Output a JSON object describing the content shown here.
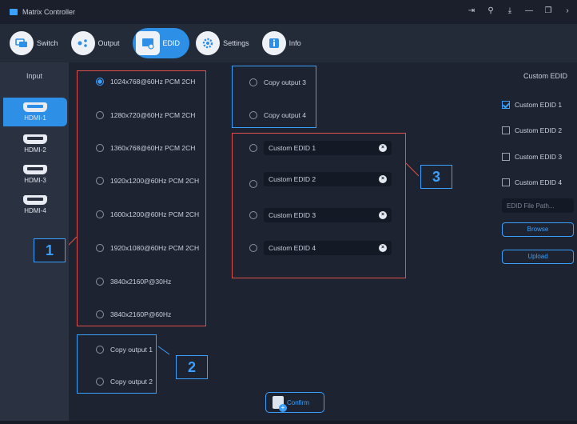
{
  "window": {
    "title": "Matrix Controller"
  },
  "nav": {
    "tabs": [
      {
        "label": "Switch",
        "icon": "switch-icon"
      },
      {
        "label": "Output",
        "icon": "output-icon"
      },
      {
        "label": "EDID",
        "icon": "edid-icon",
        "active": true
      },
      {
        "label": "Settings",
        "icon": "gear-icon"
      },
      {
        "label": "Info",
        "icon": "info-icon"
      }
    ]
  },
  "sidebar": {
    "title": "Input",
    "inputs": [
      {
        "label": "HDMI-1",
        "active": true
      },
      {
        "label": "HDMI-2"
      },
      {
        "label": "HDMI-3"
      },
      {
        "label": "HDMI-4"
      }
    ]
  },
  "edid_presets": [
    {
      "label": "1024x768@60Hz PCM 2CH",
      "checked": true
    },
    {
      "label": "1280x720@60Hz PCM 2CH"
    },
    {
      "label": "1360x768@60Hz PCM  2CH"
    },
    {
      "label": "1920x1200@60Hz PCM  2CH"
    },
    {
      "label": "1600x1200@60Hz PCM 2CH"
    },
    {
      "label": "1920x1080@60Hz PCM 2CH"
    },
    {
      "label": "3840x2160P@30Hz"
    },
    {
      "label": "3840x2160P@60Hz"
    }
  ],
  "copy_outputs_left": [
    {
      "label": "Copy output 1"
    },
    {
      "label": "Copy output 2"
    }
  ],
  "copy_outputs_right": [
    {
      "label": "Copy output 3"
    },
    {
      "label": "Copy output 4"
    }
  ],
  "custom_edid_slots": [
    {
      "label": "Custom EDID 1"
    },
    {
      "label": "Custom EDID 2"
    },
    {
      "label": "Custom EDID 3"
    },
    {
      "label": "Custom EDID 4"
    }
  ],
  "custom_panel": {
    "title": "Custom EDID",
    "checks": [
      {
        "label": "Custom EDID 1",
        "checked": true
      },
      {
        "label": "Custom EDID 2"
      },
      {
        "label": "Custom EDID 3"
      },
      {
        "label": "Custom EDID 4"
      }
    ],
    "path_placeholder": "EDID File Path...",
    "browse_label": "Browse",
    "upload_label": "Upload"
  },
  "confirm_label": "Confirm",
  "callouts": {
    "one": "1",
    "two": "2",
    "three": "3"
  },
  "colors": {
    "accent": "#2e8fe6",
    "annotation_red": "#e0504a",
    "annotation_blue": "#3aa0ff"
  }
}
